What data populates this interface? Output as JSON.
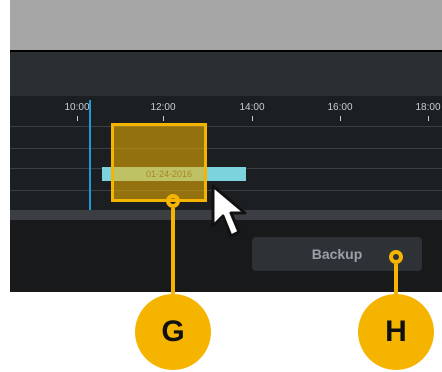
{
  "timeline": {
    "time_labels": [
      "10:00",
      "12:00",
      "14:00",
      "16:00",
      "18:00"
    ],
    "recording_date": "01-24-2016"
  },
  "controls": {
    "backup_label": "Backup"
  },
  "callouts": {
    "g_label": "G",
    "h_label": "H"
  },
  "colors": {
    "callout": "#f5b400",
    "now_marker": "#1d9bd8",
    "recording": "#7dd3dd"
  }
}
